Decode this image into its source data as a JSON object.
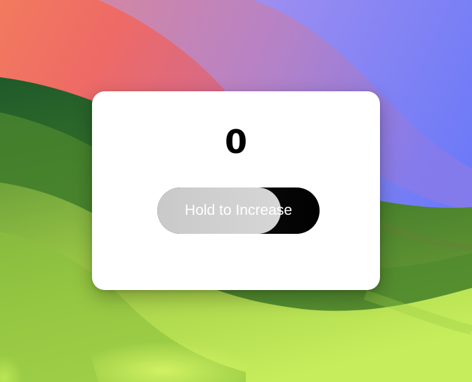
{
  "counter": {
    "value": "0"
  },
  "hold_button": {
    "label": "Hold to Increase",
    "progress": 0.76,
    "fill_color": "#cfcfcf",
    "track_color": "#000000"
  },
  "wallpaper": {
    "description_colors": {
      "red": "#f06a62",
      "blue": "#6f7cf6",
      "green": "#7fb23a",
      "light_green": "#c4f05a"
    }
  }
}
